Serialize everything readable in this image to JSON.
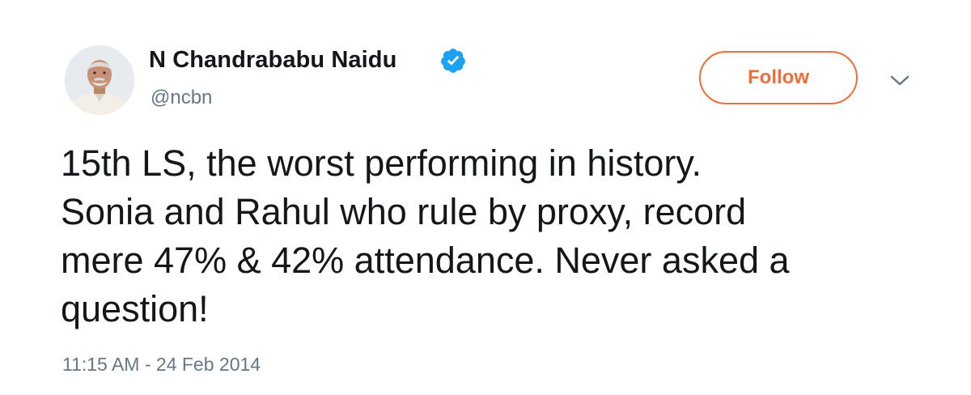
{
  "author": {
    "display_name": "N Chandrababu Naidu",
    "handle": "@ncbn",
    "verified": true,
    "avatar_icon": "profile-photo"
  },
  "actions": {
    "follow_label": "Follow",
    "more_icon": "chevron-down-icon"
  },
  "tweet": {
    "lines": [
      "15th LS, the worst performing in history.",
      "Sonia and Rahul who rule by proxy, record",
      "mere 47% & 42% attendance. Never asked a",
      "question!"
    ],
    "timestamp": "11:15 AM - 24 Feb 2014"
  },
  "colors": {
    "accent": "#f06d3a",
    "verified_blue": "#1da1f2",
    "text_primary": "#14171a",
    "text_secondary": "#657786"
  }
}
